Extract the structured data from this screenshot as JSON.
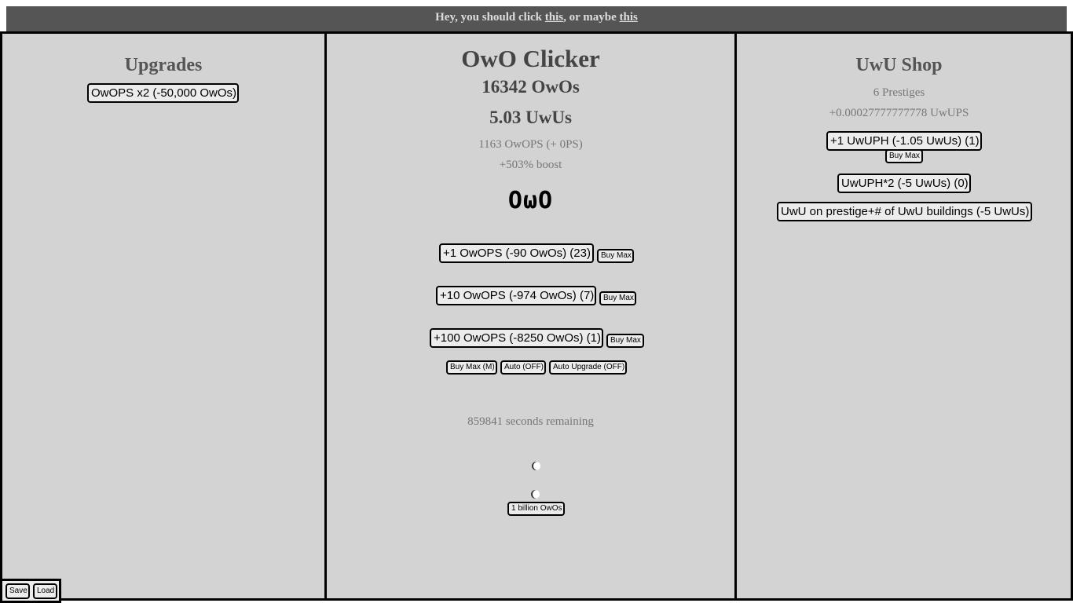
{
  "banner": {
    "text_before": "Hey, you should click ",
    "link1": "this",
    "text_middle": ", or maybe ",
    "link2": "this"
  },
  "upgrades": {
    "title": "Upgrades",
    "owops_x2_button": "OwOPS x2 (-50,000 OwOs)"
  },
  "main": {
    "title": "OwO Clicker",
    "owos": "16342 OwOs",
    "uwus": "5.03 UwUs",
    "owops": "1163 OwOPS (+ 0PS)",
    "boost": "+503% boost",
    "clicker_face": "OωO",
    "buy_buttons": [
      {
        "label": "+1 OwOPS (-90 OwOs) (23)",
        "max_label": "Buy Max"
      },
      {
        "label": "+10 OwOPS (-974 OwOs) (7)",
        "max_label": "Buy Max"
      },
      {
        "label": "+100 OwOPS (-8250 OwOs) (1)",
        "max_label": "Buy Max"
      }
    ],
    "controls": {
      "buy_max_all": "Buy Max (M)",
      "auto": "Auto (OFF)",
      "auto_upgrade": "Auto Upgrade (OFF)"
    },
    "remaining": "859841 seconds remaining",
    "billion_button": "1 billion OwOs"
  },
  "shop": {
    "title": "UwU Shop",
    "prestiges": "6 Prestiges",
    "uwups": "+0.00027777777778 UwUPS",
    "uwuph_button": "+1 UwUPH (-1.05 UwUs) (1)",
    "uwuph_max": "Buy Max",
    "uwuph_x2_button": "UwUPH*2 (-5 UwUs) (0)",
    "prestige_button": "UwU on prestige+# of UwU buildings (-5 UwUs)"
  },
  "footer": {
    "save": "Save",
    "load": "Load"
  }
}
